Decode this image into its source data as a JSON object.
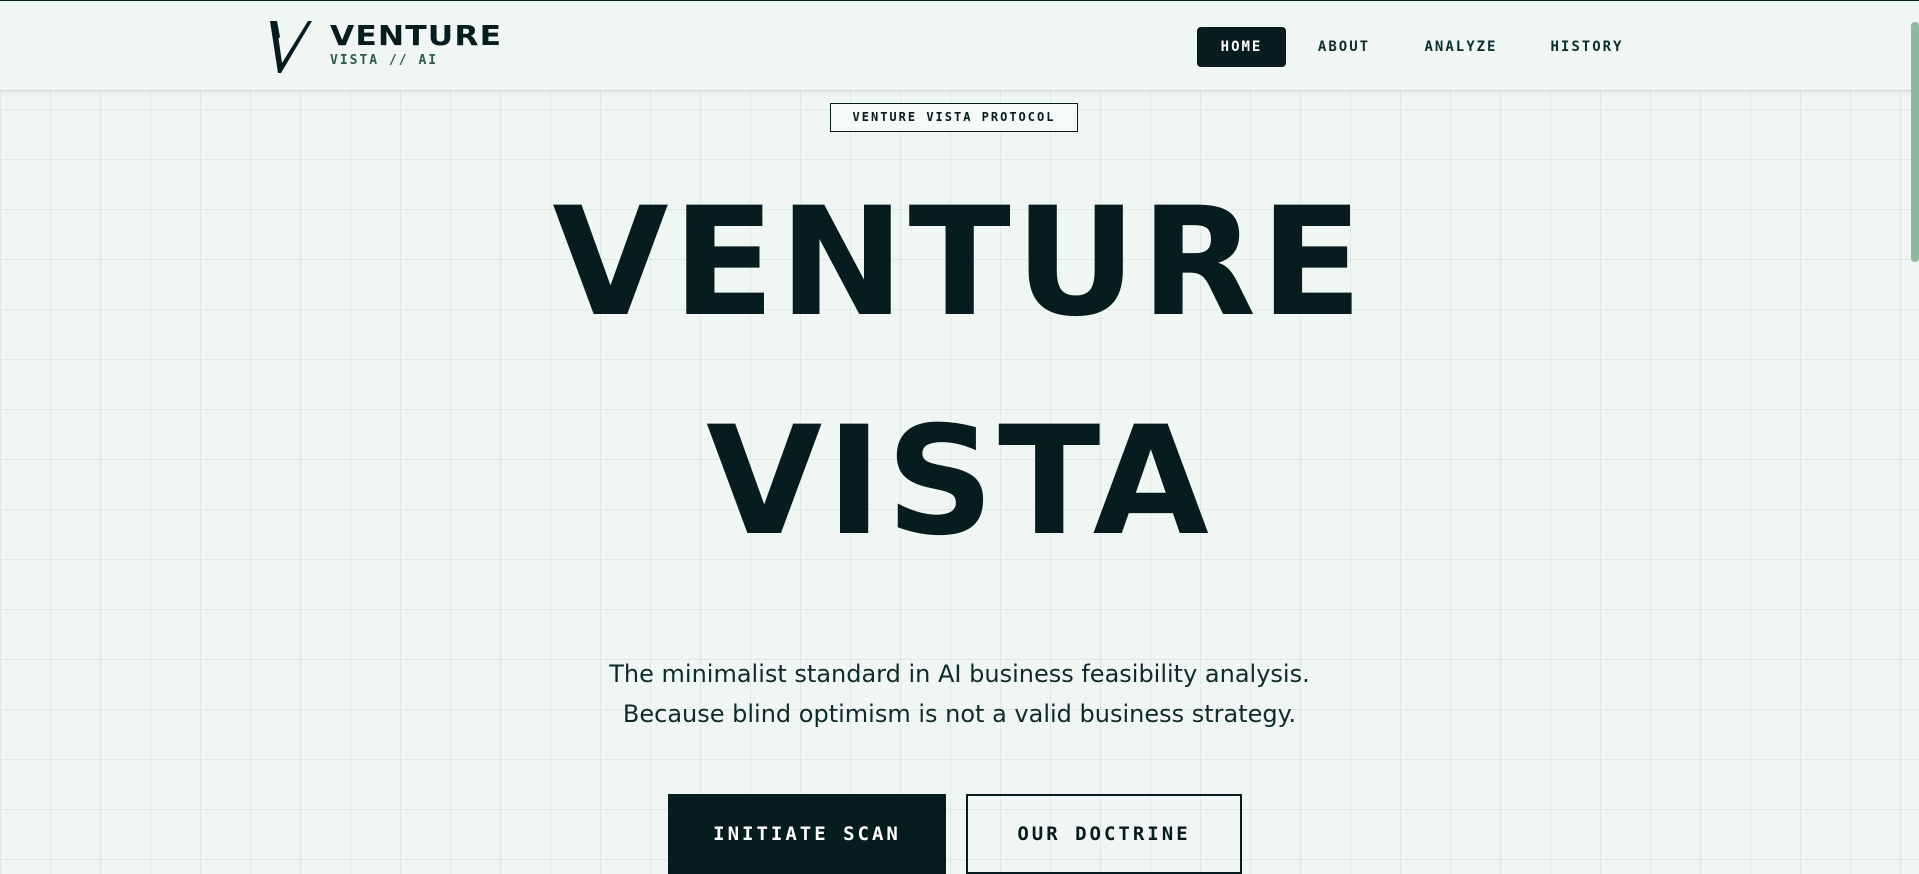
{
  "brand": {
    "logo_letter": "V",
    "name": "VENTURE",
    "subtitle": "VISTA // AI"
  },
  "nav": {
    "items": [
      {
        "label": "HOME",
        "active": true
      },
      {
        "label": "ABOUT",
        "active": false
      },
      {
        "label": "ANALYZE",
        "active": false
      },
      {
        "label": "HISTORY",
        "active": false
      }
    ]
  },
  "hero": {
    "badge": "VENTURE VISTA PROTOCOL",
    "title_line1": "VENTURE",
    "title_line2": "VISTA",
    "tagline_line1": "The minimalist standard in AI business feasibility analysis.",
    "tagline_line2": "Because blind optimism is not a valid business strategy.",
    "primary_cta": "INITIATE SCAN",
    "secondary_cta": "OUR DOCTRINE"
  },
  "colors": {
    "background": "#f0f6f3",
    "ink": "#061c1f",
    "accent_green": "#8fb89d",
    "grid_line": "#dde8e3"
  },
  "icons": {
    "logo": "v-monogram-icon"
  }
}
